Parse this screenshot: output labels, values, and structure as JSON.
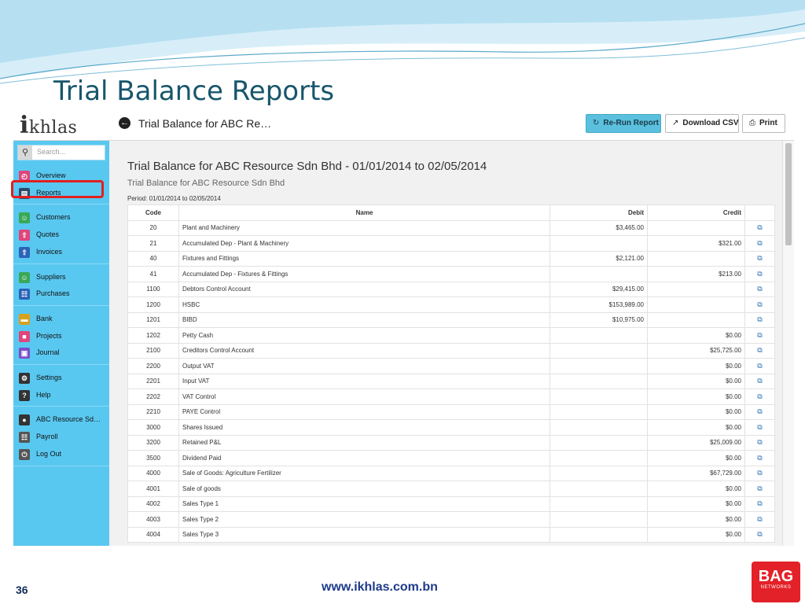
{
  "slide": {
    "title": "Trial Balance Reports",
    "page_number": "36",
    "website": "www.ikhlas.com.bn",
    "brand_logo_main": "BAG",
    "brand_logo_sub": "NETWORKS"
  },
  "app": {
    "logo_initial": "i",
    "logo_rest": "khlas",
    "breadcrumb": "Trial Balance for ABC Re…",
    "buttons": {
      "rerun": "Re-Run Report",
      "csv": "Download CSV",
      "print": "Print"
    }
  },
  "sidebar": {
    "search_placeholder": "Search...",
    "groups": [
      [
        {
          "label": "Overview",
          "icon": "gauge-icon",
          "color": "#e0457b"
        },
        {
          "label": "Reports",
          "icon": "chart-icon",
          "color": "#2e4a6b"
        }
      ],
      [
        {
          "label": "Customers",
          "icon": "people-icon",
          "color": "#3aa857"
        },
        {
          "label": "Quotes",
          "icon": "upload-icon",
          "color": "#e0457b"
        },
        {
          "label": "Invoices",
          "icon": "upload-icon",
          "color": "#2b63b8"
        }
      ],
      [
        {
          "label": "Suppliers",
          "icon": "people-icon",
          "color": "#3aa857"
        },
        {
          "label": "Purchases",
          "icon": "cart-icon",
          "color": "#2b63b8"
        }
      ],
      [
        {
          "label": "Bank",
          "icon": "bank-icon",
          "color": "#d8a21e"
        },
        {
          "label": "Projects",
          "icon": "folder-icon",
          "color": "#e0457b"
        },
        {
          "label": "Journal",
          "icon": "book-icon",
          "color": "#7a4fc9"
        }
      ],
      [
        {
          "label": "Settings",
          "icon": "gear-icon",
          "color": "#333333"
        },
        {
          "label": "Help",
          "icon": "question-icon",
          "color": "#333333"
        }
      ],
      [
        {
          "label": "ABC Resource Sd…",
          "icon": "user-icon",
          "color": "#333333"
        },
        {
          "label": "Payroll",
          "icon": "cart-icon",
          "color": "#555555"
        },
        {
          "label": "Log Out",
          "icon": "power-icon",
          "color": "#555555"
        }
      ]
    ]
  },
  "report": {
    "title": "Trial Balance for ABC Resource Sdn Bhd - 01/01/2014 to 02/05/2014",
    "subtitle": "Trial Balance for ABC Resource Sdn Bhd",
    "period": "Period: 01/01/2014 to 02/05/2014",
    "columns": {
      "code": "Code",
      "name": "Name",
      "debit": "Debit",
      "credit": "Credit"
    },
    "rows": [
      {
        "code": "20",
        "name": "Plant and Machinery",
        "debit": "$3,465.00",
        "credit": ""
      },
      {
        "code": "21",
        "name": "Accumulated Dep - Plant & Machinery",
        "debit": "",
        "credit": "$321.00"
      },
      {
        "code": "40",
        "name": "Fixtures and Fittings",
        "debit": "$2,121.00",
        "credit": ""
      },
      {
        "code": "41",
        "name": "Accumulated Dep - Fixtures & Fittings",
        "debit": "",
        "credit": "$213.00"
      },
      {
        "code": "1100",
        "name": "Debtors Control Account",
        "debit": "$29,415.00",
        "credit": ""
      },
      {
        "code": "1200",
        "name": "HSBC",
        "debit": "$153,989.00",
        "credit": ""
      },
      {
        "code": "1201",
        "name": "BIBD",
        "debit": "$10,975.00",
        "credit": ""
      },
      {
        "code": "1202",
        "name": "Petty Cash",
        "debit": "",
        "credit": "$0.00"
      },
      {
        "code": "2100",
        "name": "Creditors Control Account",
        "debit": "",
        "credit": "$25,725.00"
      },
      {
        "code": "2200",
        "name": "Output VAT",
        "debit": "",
        "credit": "$0.00"
      },
      {
        "code": "2201",
        "name": "Input VAT",
        "debit": "",
        "credit": "$0.00"
      },
      {
        "code": "2202",
        "name": "VAT Control",
        "debit": "",
        "credit": "$0.00"
      },
      {
        "code": "2210",
        "name": "PAYE Control",
        "debit": "",
        "credit": "$0.00"
      },
      {
        "code": "3000",
        "name": "Shares Issued",
        "debit": "",
        "credit": "$0.00"
      },
      {
        "code": "3200",
        "name": "Retained P&L",
        "debit": "",
        "credit": "$25,009.00"
      },
      {
        "code": "3500",
        "name": "Dividend Paid",
        "debit": "",
        "credit": "$0.00"
      },
      {
        "code": "4000",
        "name": "Sale of Goods: Agriculture Fertilizer",
        "debit": "",
        "credit": "$67,729.00"
      },
      {
        "code": "4001",
        "name": "Sale of goods",
        "debit": "",
        "credit": "$0.00"
      },
      {
        "code": "4002",
        "name": "Sales Type 1",
        "debit": "",
        "credit": "$0.00"
      },
      {
        "code": "4003",
        "name": "Sales Type 2",
        "debit": "",
        "credit": "$0.00"
      },
      {
        "code": "4004",
        "name": "Sales Type 3",
        "debit": "",
        "credit": "$0.00"
      }
    ]
  }
}
